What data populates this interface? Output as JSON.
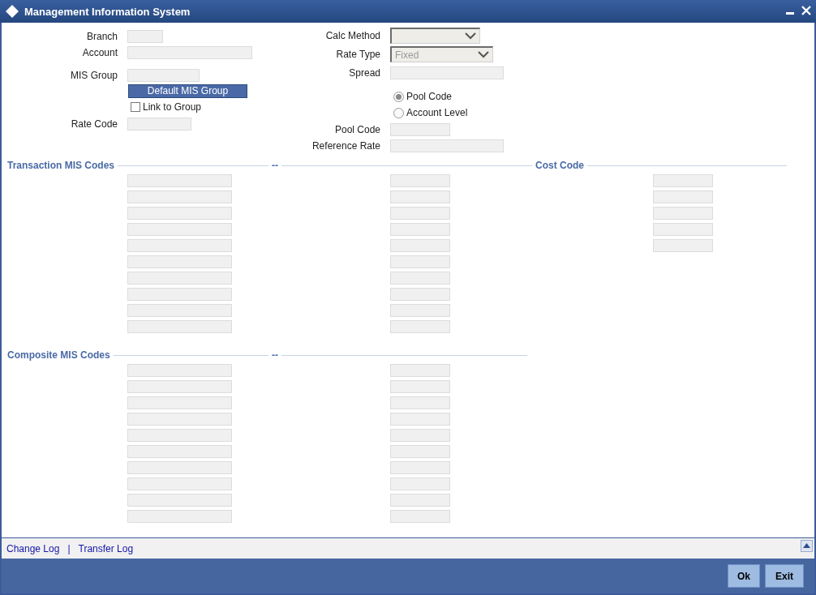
{
  "window": {
    "title": "Management Information System"
  },
  "left_fields": [
    {
      "kind": "text",
      "label": "Branch"
    },
    {
      "kind": "text",
      "label": "Account"
    },
    {
      "kind": "text",
      "label": "MIS Group"
    },
    {
      "kind": "button",
      "label": "Default MIS Group"
    },
    {
      "kind": "checkbox",
      "label": "Link to Group",
      "checked": false
    },
    {
      "kind": "text",
      "label": "Rate Code"
    }
  ],
  "right_fields": [
    {
      "kind": "select",
      "label": "Calc Method"
    },
    {
      "kind": "select",
      "label": "Rate Type",
      "value": "Fixed"
    },
    {
      "kind": "text",
      "label": "Spread"
    },
    {
      "kind": "radio",
      "label": "Pool Code",
      "selected": true
    },
    {
      "kind": "radio",
      "label": "Account Level",
      "selected": false
    },
    {
      "kind": "text",
      "label": "Pool Code"
    },
    {
      "kind": "text",
      "label": "Reference Rate"
    }
  ],
  "transaction_mis_codes": {
    "title": "Transaction MIS Codes",
    "column_2_title": "--",
    "column_3_title": "Cost Code"
  },
  "composite_mis_codes": {
    "title": "Composite MIS Codes",
    "column_2_title": "--"
  },
  "footer_links": [
    "Change Log",
    "|",
    "Transfer Log"
  ],
  "buttons": [
    "Ok",
    "Exit"
  ]
}
